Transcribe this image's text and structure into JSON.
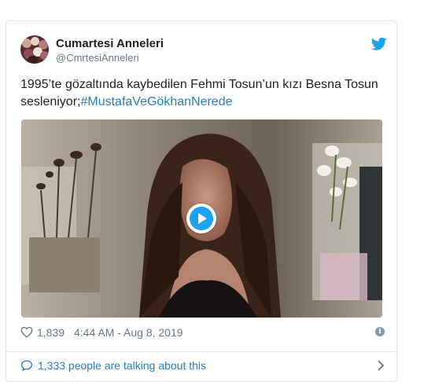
{
  "tweet": {
    "author_name": "Cumartesi Anneleri",
    "author_handle": "@CmrtesiAnneleri",
    "text_plain": "1995’te gözaltında kaybedilen Fehmi Tosun’un kızı Besna Tosun sesleniyor;",
    "hashtag": "#MustafaVeGökhanNerede",
    "like_count": "1,839",
    "timestamp": "4:44 AM - Aug 8, 2019",
    "talking": "1,333 people are talking about this"
  },
  "icons": {
    "brand": "twitter-bird-icon",
    "like": "heart-icon",
    "info": "info-icon",
    "comment": "speech-bubble-icon",
    "more": "chevron-right-icon",
    "play": "play-icon"
  },
  "colors": {
    "link": "#2b7bb9",
    "brand": "#1da1f2",
    "muted": "#697882",
    "border": "#e1e8ed"
  }
}
